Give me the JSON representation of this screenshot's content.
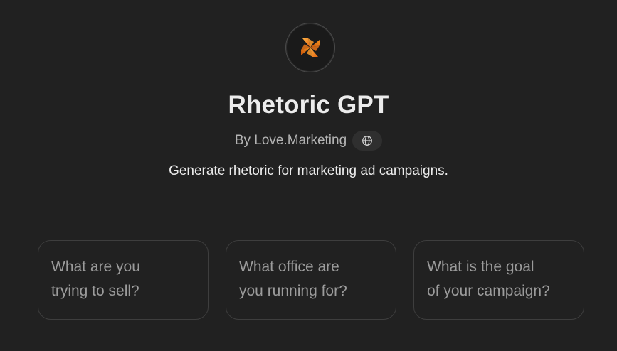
{
  "gpt": {
    "logo_icon": "pinwheel-logo-icon",
    "title": "Rhetoric GPT",
    "author": "By Love.Marketing",
    "author_link_icon": "globe-icon",
    "description": "Generate rhetoric for marketing ad campaigns."
  },
  "conversation_starters": [
    {
      "text": "What are you\ntrying to sell?"
    },
    {
      "text": "What office are\nyou running for?"
    },
    {
      "text": "What is the goal\nof your campaign?"
    }
  ],
  "colors": {
    "background": "#212121",
    "accent_orange": "#f28a1e",
    "card_border": "#3e3e3e"
  }
}
